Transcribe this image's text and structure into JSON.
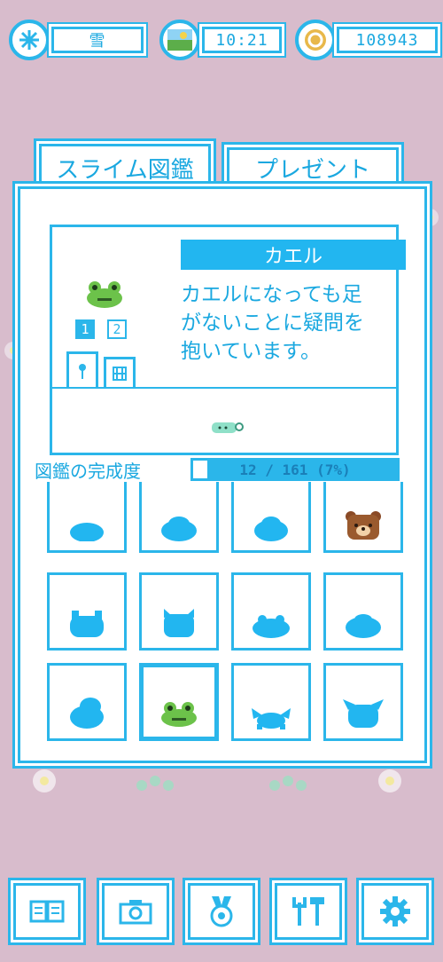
{
  "status": {
    "weather": "雪",
    "time": "10:21",
    "coins": "108943"
  },
  "tabs": {
    "encyclopedia": "スライム図鑑",
    "present": "プレゼント"
  },
  "detail": {
    "name": "カエル",
    "description": "カエルになっても足\nがないことに疑問を\n抱いています。",
    "page_1": "1",
    "page_2": "2"
  },
  "completion": {
    "label": "図鑑の完成度",
    "value": "12 / 161 (7%)",
    "progress_fraction": 0.07
  },
  "colors": {
    "accent": "#2bb6ea",
    "background": "#d8bccc",
    "frog": "#6cc24a"
  },
  "bottom_nav": [
    {
      "icon": "book-icon"
    },
    {
      "icon": "camera-icon"
    },
    {
      "icon": "medal-icon"
    },
    {
      "icon": "tools-icon"
    },
    {
      "icon": "gear-icon"
    }
  ]
}
